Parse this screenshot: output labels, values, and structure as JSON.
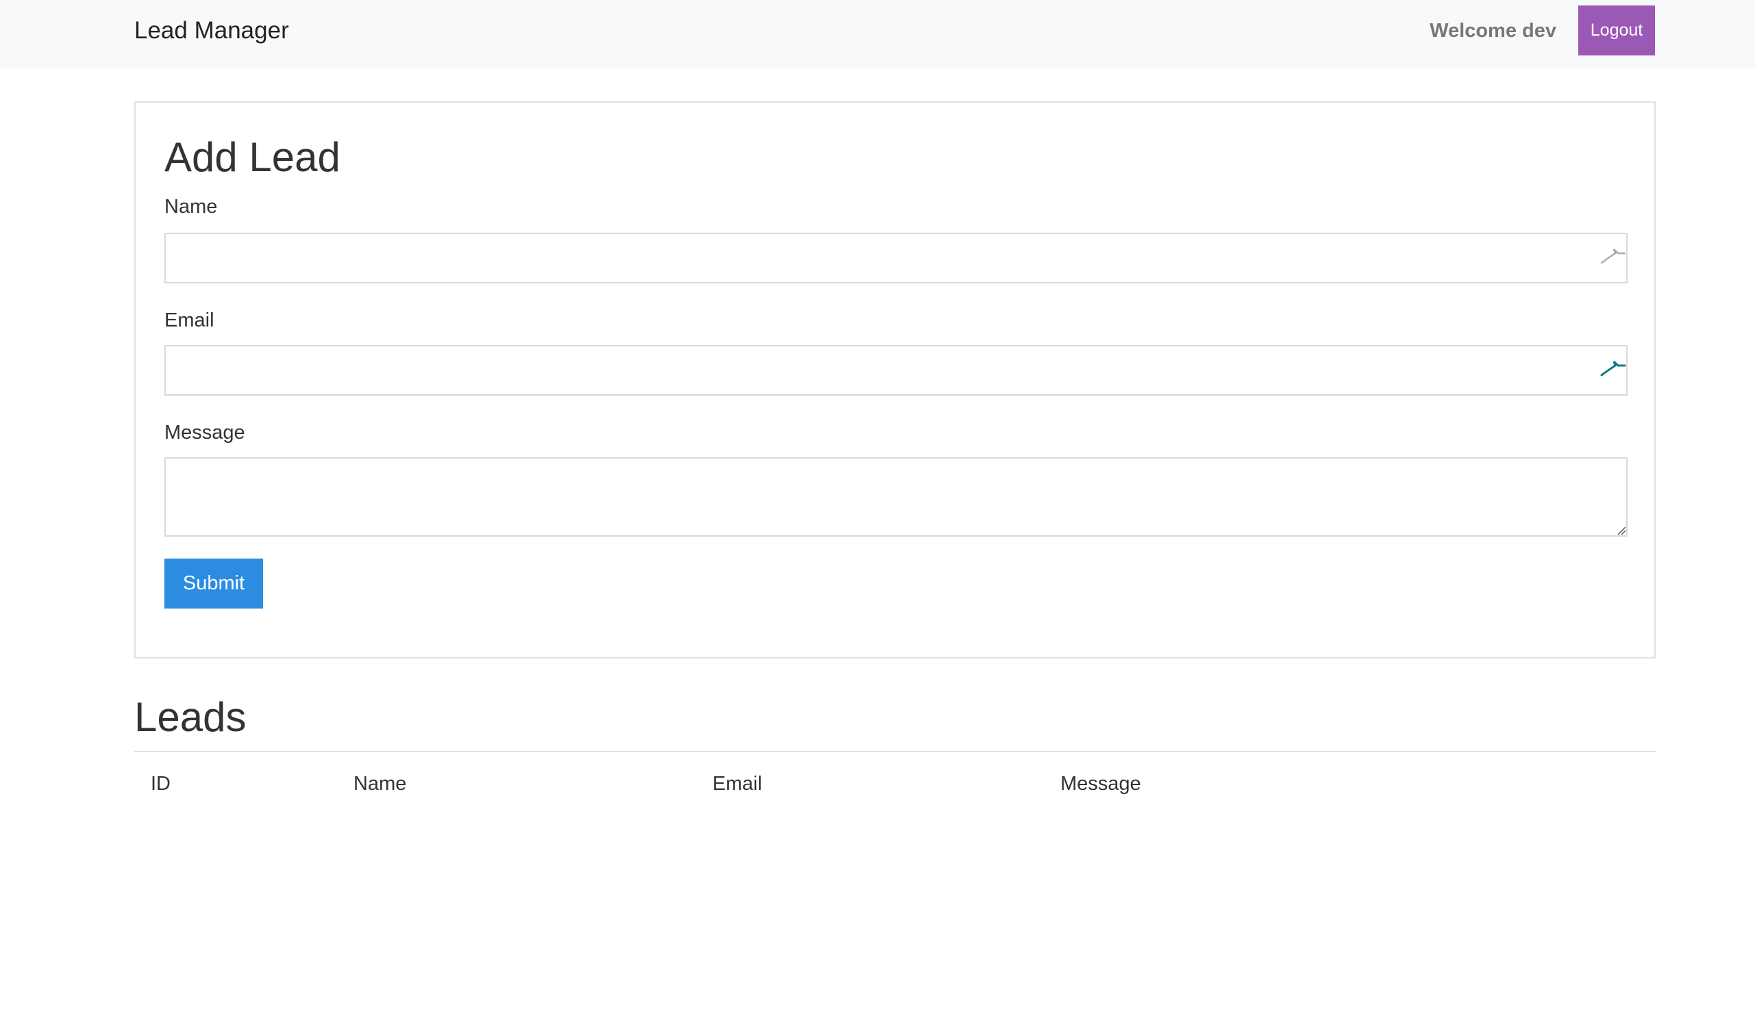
{
  "navbar": {
    "brand": "Lead Manager",
    "welcome_text": "Welcome dev",
    "logout_label": "Logout"
  },
  "form": {
    "title": "Add Lead",
    "name_label": "Name",
    "name_value": "",
    "email_label": "Email",
    "email_value": "",
    "message_label": "Message",
    "message_value": "",
    "submit_label": "Submit"
  },
  "leads": {
    "title": "Leads",
    "columns": [
      "ID",
      "Name",
      "Email",
      "Message"
    ],
    "rows": []
  },
  "colors": {
    "navbar_bg": "#f8f9fa",
    "logout_bg": "#9b59b6",
    "submit_bg": "#2c8ce0",
    "password_manager_icon_active": "#0e7c86",
    "password_manager_icon_inactive": "#aaaaaa"
  },
  "icons": {
    "name_field_icon": "password-manager-icon",
    "email_field_icon": "password-manager-icon"
  }
}
